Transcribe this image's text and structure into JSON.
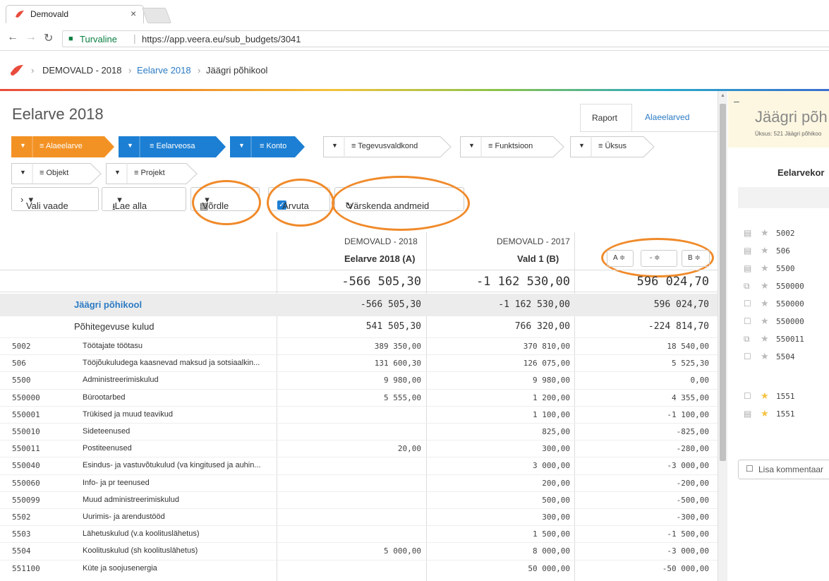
{
  "browser": {
    "tab_title": "Demovald",
    "tab_close": "×",
    "secure_label": "Turvaline",
    "url": "https://app.veera.eu/sub_budgets/3041"
  },
  "breadcrumb": {
    "items": [
      "DEMOVALD - 2018",
      "Eelarve 2018",
      "Jäägri põhikool"
    ]
  },
  "colors": {
    "accent_orange": "#f08a2a",
    "filter_orange": "#f39224",
    "filter_blue": "#1c7fd3",
    "link_blue": "#2c7bc4",
    "danger_red": "#e74c3c"
  },
  "main": {
    "title": "Eelarve 2018",
    "tabs": [
      "Raport",
      "Alaeelarved"
    ],
    "filters_row1": [
      {
        "label": "Alaeelarve",
        "style": "orange"
      },
      {
        "label": "Eelarveosa",
        "style": "blue"
      },
      {
        "label": "Konto",
        "style": "blue"
      },
      {
        "label": "Tegevusvaldkond",
        "style": "plain"
      },
      {
        "label": "Funktsioon",
        "style": "plain"
      },
      {
        "label": "Üksus",
        "style": "plain"
      }
    ],
    "filters_row2": [
      {
        "label": "Objekt",
        "style": "plain"
      },
      {
        "label": "Projekt",
        "style": "plain"
      }
    ],
    "toolbar": {
      "select_view": "Vali vaade",
      "download": "Lae alla",
      "compare": "Võrdle",
      "calculate": "Arvuta",
      "refresh": "Värskenda andmeid"
    },
    "columns": {
      "a_org": "DEMOVALD - 2018",
      "a_name": "Eelarve 2018 (A)",
      "b_org": "DEMOVALD - 2017",
      "b_name": "Vald 1 (B)",
      "sort_a": "A ≑",
      "sort_op": "- ≑",
      "sort_b": "B ≑"
    },
    "total": {
      "a": "-566 505,30",
      "b": "-1 162 530,00",
      "d": "596 024,70"
    },
    "group": {
      "name": "Jäägri põhikool",
      "a": "-566 505,30",
      "b": "-1 162 530,00",
      "d": "596 024,70"
    },
    "subgroup": {
      "name": "Põhitegevuse kulud",
      "a": "541 505,30",
      "b": "766 320,00",
      "d": "-224 814,70"
    },
    "rows": [
      {
        "code": "5002",
        "name": "Töötajate töötasu",
        "a": "389 350,00",
        "b": "370 810,00",
        "d": "18 540,00"
      },
      {
        "code": "506",
        "name": "Tööjõukuludega kaasnevad maksud ja sotsiaalkin...",
        "a": "131 600,30",
        "b": "126 075,00",
        "d": "5 525,30"
      },
      {
        "code": "5500",
        "name": "Administreerimiskulud",
        "a": "9 980,00",
        "b": "9 980,00",
        "d": "0,00"
      },
      {
        "code": "550000",
        "name": "Bürootarbed",
        "a": "5 555,00",
        "b": "1 200,00",
        "d": "4 355,00"
      },
      {
        "code": "550001",
        "name": "Trükised ja muud teavikud",
        "a": "",
        "b": "1 100,00",
        "d": "-1 100,00"
      },
      {
        "code": "550010",
        "name": "Sideteenused",
        "a": "",
        "b": "825,00",
        "d": "-825,00"
      },
      {
        "code": "550011",
        "name": "Postiteenused",
        "a": "20,00",
        "b": "300,00",
        "d": "-280,00"
      },
      {
        "code": "550040",
        "name": "Esindus- ja vastuvõtukulud (va kingitused ja auhin...",
        "a": "",
        "b": "3 000,00",
        "d": "-3 000,00"
      },
      {
        "code": "550060",
        "name": "Info- ja pr teenused",
        "a": "",
        "b": "200,00",
        "d": "-200,00"
      },
      {
        "code": "550099",
        "name": "Muud administreerimiskulud",
        "a": "",
        "b": "500,00",
        "d": "-500,00"
      },
      {
        "code": "5502",
        "name": "Uurimis- ja arendustööd",
        "a": "",
        "b": "300,00",
        "d": "-300,00"
      },
      {
        "code": "5503",
        "name": "Lähetuskulud (v.a koolituslähetus)",
        "a": "",
        "b": "1 500,00",
        "d": "-1 500,00"
      },
      {
        "code": "5504",
        "name": "Koolituskulud (sh koolituslähetus)",
        "a": "5 000,00",
        "b": "8 000,00",
        "d": "-3 000,00"
      },
      {
        "code": "551100",
        "name": "Küte ja soojusenergia",
        "a": "",
        "b": "50 000,00",
        "d": "-50 000,00"
      }
    ]
  },
  "side": {
    "title": "Jäägri põh",
    "subtitle": "Üksus: 521 Jäägri põhikoo",
    "column_header": "Eelarvekor",
    "items": [
      {
        "icon": "document-icon",
        "star": false,
        "code": "5002"
      },
      {
        "icon": "document-icon",
        "star": false,
        "code": "506"
      },
      {
        "icon": "document-icon",
        "star": false,
        "code": "5500"
      },
      {
        "icon": "comments-icon",
        "star": false,
        "code": "550000"
      },
      {
        "icon": "comment-icon",
        "star": false,
        "code": "550000"
      },
      {
        "icon": "comment-icon",
        "star": false,
        "code": "550000"
      },
      {
        "icon": "comments-icon",
        "star": false,
        "code": "550011"
      },
      {
        "icon": "comment-icon",
        "star": false,
        "code": "5504"
      },
      {
        "icon": "comment-icon",
        "star": true,
        "code": "1551"
      },
      {
        "icon": "document-icon",
        "star": true,
        "code": "1551"
      }
    ],
    "add_comment": "Lisa kommentaar"
  }
}
